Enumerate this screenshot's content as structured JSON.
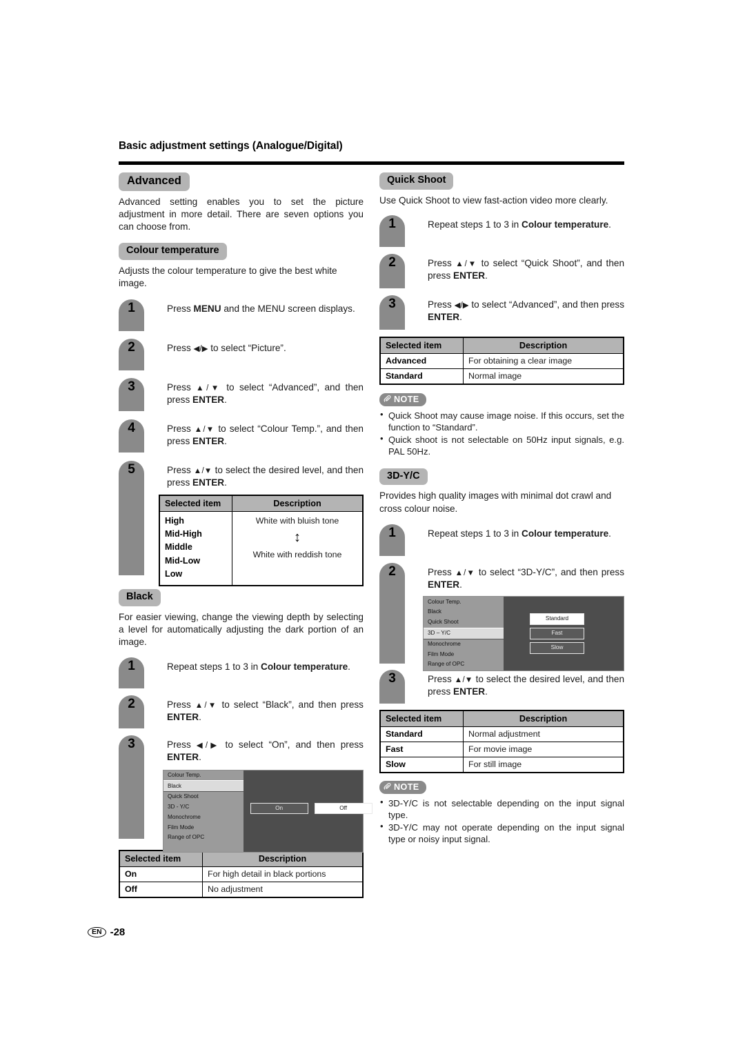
{
  "header": {
    "title": "Basic adjustment settings (Analogue/Digital)"
  },
  "footer": {
    "lang": "EN",
    "page": "-28"
  },
  "labels": {
    "note": "NOTE",
    "selected_item": "Selected item",
    "description": "Description"
  },
  "left": {
    "advanced": {
      "badge": "Advanced",
      "body": "Advanced setting enables you to set the picture adjustment in more detail.  There are seven options you can choose from."
    },
    "colour_temperature": {
      "badge": "Colour temperature",
      "body": "Adjusts the colour temperature to give the best white image.",
      "steps": [
        {
          "num": "1",
          "text": "Press MENU and the MENU screen displays."
        },
        {
          "num": "2",
          "text": "Press ◀/▶ to select “Picture”."
        },
        {
          "num": "3",
          "text": "Press ▲/▼ to select “Advanced”, and then press ENTER."
        },
        {
          "num": "4",
          "text": "Press ▲/▼ to select “Colour Temp.”, and then press ENTER."
        },
        {
          "num": "5",
          "text": "Press ▲/▼ to select the desired level, and then press ENTER."
        }
      ],
      "table": {
        "items": [
          "High",
          "Mid-High",
          "Middle",
          "Mid-Low",
          "Low"
        ],
        "desc_top": "White with bluish tone",
        "desc_bottom": "White with reddish tone",
        "arrow": "↕"
      }
    },
    "black": {
      "badge": "Black",
      "body": "For easier viewing, change the viewing depth by selecting a level for automatically adjusting the dark portion of an image.",
      "steps": [
        {
          "num": "1",
          "text": "Repeat steps 1 to 3 in Colour temperature."
        },
        {
          "num": "2",
          "text": "Press ▲/▼ to select “Black”, and then press ENTER."
        },
        {
          "num": "3",
          "text": "Press ◀/▶ to select “On”, and then press ENTER."
        }
      ],
      "osd": {
        "menu": [
          "Colour Temp.",
          "Black",
          "Quick Shoot",
          "3D - Y/C",
          "Monochrome",
          "Film Mode",
          "Range of OPC"
        ],
        "selected_index": 1,
        "options": [
          {
            "label": "On",
            "state": "selected"
          },
          {
            "label": "Off",
            "state": "normal"
          }
        ]
      },
      "table": {
        "rows": [
          {
            "item": "On",
            "desc": "For high detail in black portions"
          },
          {
            "item": "Off",
            "desc": "No adjustment"
          }
        ]
      }
    }
  },
  "right": {
    "quick_shoot": {
      "badge": "Quick Shoot",
      "body": "Use Quick Shoot to view fast-action video more clearly.",
      "steps": [
        {
          "num": "1",
          "text": "Repeat steps 1 to 3 in Colour temperature."
        },
        {
          "num": "2",
          "text": "Press ▲/▼ to select “Quick Shoot”, and then press ENTER."
        },
        {
          "num": "3",
          "text": "Press ◀/▶ to select “Advanced”, and then press ENTER."
        }
      ],
      "table": {
        "rows": [
          {
            "item": "Advanced",
            "desc": "For obtaining a clear image"
          },
          {
            "item": "Standard",
            "desc": "Normal image"
          }
        ]
      },
      "notes": [
        "Quick Shoot may cause image noise. If this occurs, set the function to “Standard”.",
        "Quick shoot is not selectable on 50Hz input signals, e.g. PAL 50Hz."
      ]
    },
    "three_d_yc": {
      "badge": "3D-Y/C",
      "body": "Provides high quality images with minimal dot crawl and cross colour noise.",
      "steps": [
        {
          "num": "1",
          "text": "Repeat steps 1 to 3 in Colour temperature."
        },
        {
          "num": "2",
          "text": "Press ▲/▼ to select “3D-Y/C”, and then press ENTER."
        },
        {
          "num": "3",
          "text": "Press ▲/▼ to select the desired level, and then press ENTER."
        }
      ],
      "osd": {
        "menu": [
          "Colour Temp.",
          "Black",
          "Quick Shoot",
          "3D – Y/C",
          "Monochrome",
          "Film Mode",
          "Range of OPC"
        ],
        "selected_index": 3,
        "options": [
          {
            "label": "Standard",
            "state": "selected"
          },
          {
            "label": "Fast",
            "state": "normal"
          },
          {
            "label": "Slow",
            "state": "normal"
          }
        ]
      },
      "table": {
        "rows": [
          {
            "item": "Standard",
            "desc": "Normal adjustment"
          },
          {
            "item": "Fast",
            "desc": "For movie image"
          },
          {
            "item": "Slow",
            "desc": "For still image"
          }
        ]
      },
      "notes": [
        "3D-Y/C is not selectable depending on the input signal type.",
        "3D-Y/C may not operate depending on the input signal type or noisy input signal."
      ]
    }
  },
  "colors": {
    "badge_gray": "#b4b4b4",
    "step_gray": "#8a8a8a",
    "osd_bg": "#4d4d4d",
    "osd_list": "#9b9b9b",
    "osd_sel": "#dcdcdc"
  }
}
